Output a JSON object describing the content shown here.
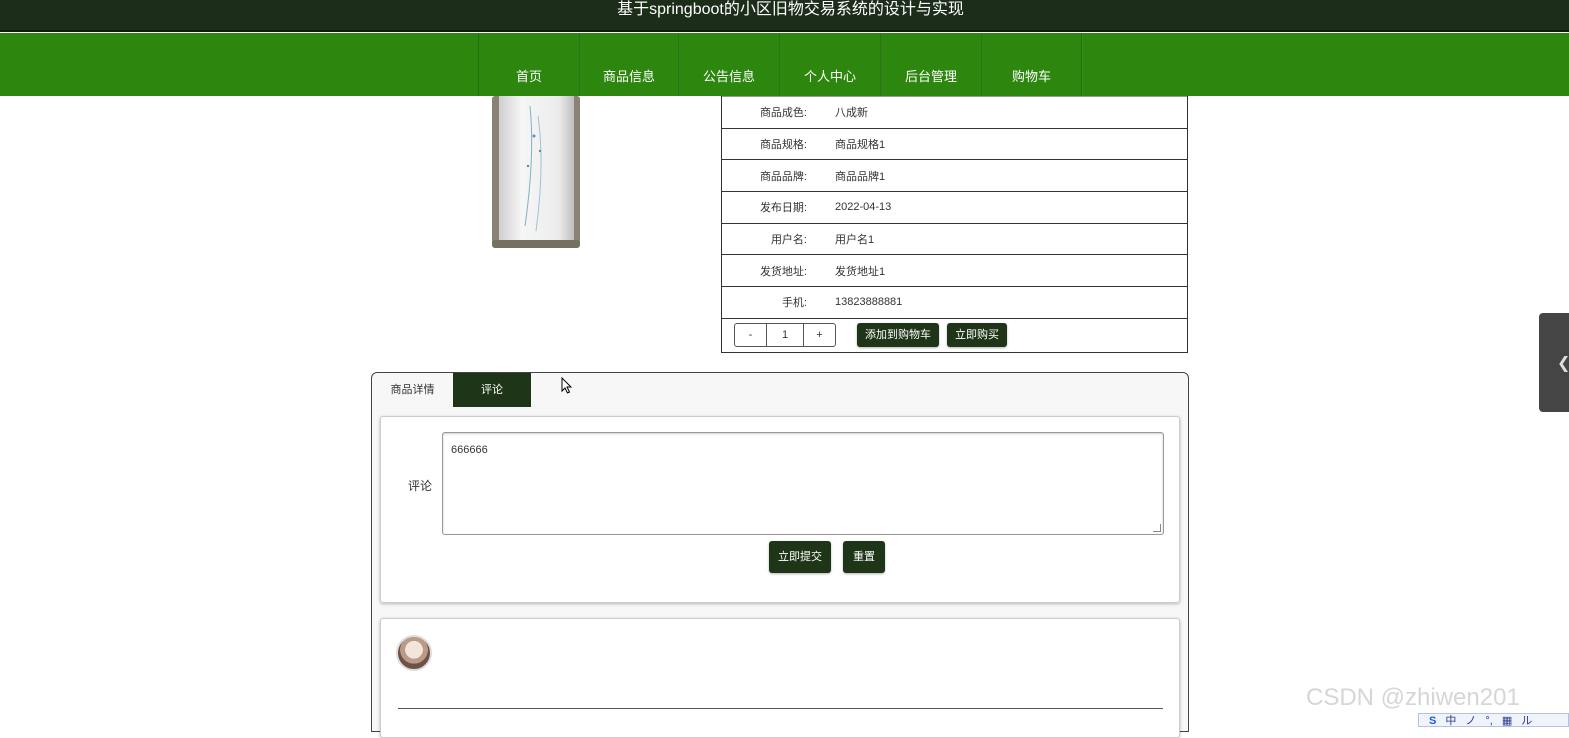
{
  "header": {
    "title": "基于springboot的小区旧物交易系统的设计与实现"
  },
  "nav": [
    "首页",
    "商品信息",
    "公告信息",
    "个人中心",
    "后台管理",
    "购物车"
  ],
  "product": {
    "rows": [
      {
        "label": "商品成色:",
        "value": "八成新"
      },
      {
        "label": "商品规格:",
        "value": "商品规格1"
      },
      {
        "label": "商品品牌:",
        "value": "商品品牌1"
      },
      {
        "label": "发布日期:",
        "value": "2022-04-13"
      },
      {
        "label": "用户名:",
        "value": "用户名1"
      },
      {
        "label": "发货地址:",
        "value": "发货地址1"
      },
      {
        "label": "手机:",
        "value": "13823888881"
      }
    ],
    "quantity": {
      "minus": "-",
      "value": "1",
      "plus": "+"
    },
    "add_cart": "添加到购物车",
    "buy_now": "立即购买"
  },
  "tabs": [
    {
      "label": "商品详情"
    },
    {
      "label": "评论",
      "active": true
    }
  ],
  "comment_form": {
    "label": "评论",
    "value": "666666",
    "submit": "立即提交",
    "reset": "重置"
  },
  "watermark": "CSDN @zhiwen201",
  "ime": [
    "中",
    "ノ",
    "°,",
    "▦",
    "ル"
  ],
  "colors": {
    "nav_green": "#2d870e",
    "dark_green": "#1f3518",
    "topbar": "#1c2d1a"
  },
  "icons": {
    "product_image": "air-conditioner-image",
    "side_handle": "chevron-left-icon",
    "avatar": "user-avatar"
  }
}
